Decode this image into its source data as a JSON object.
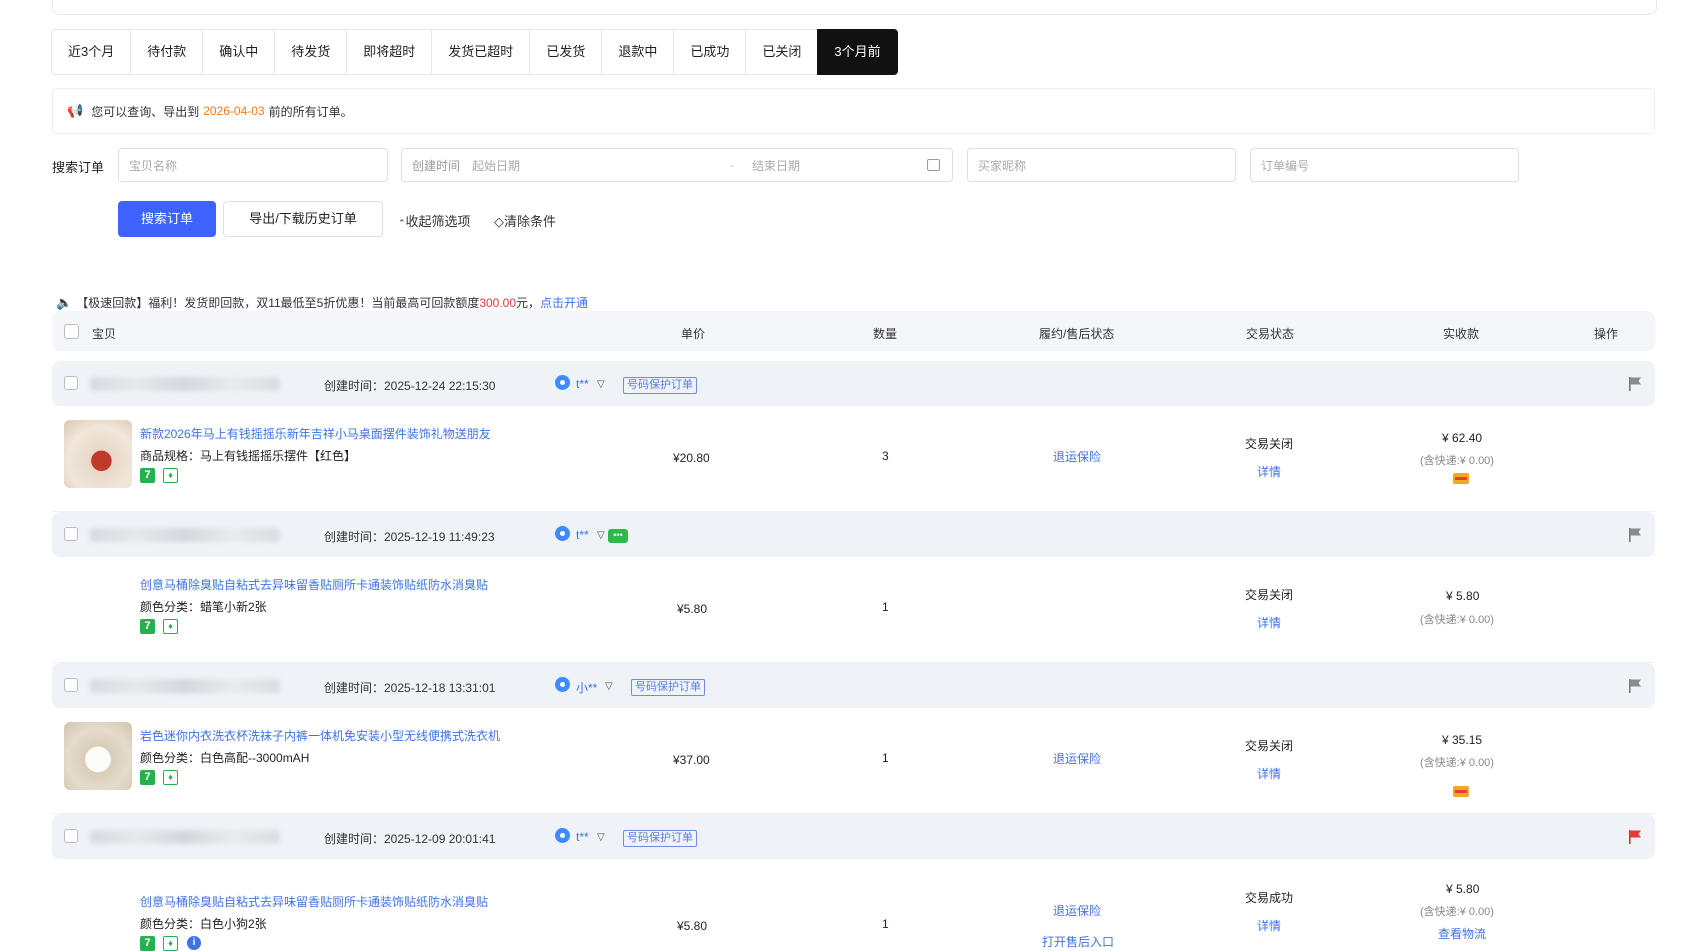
{
  "tabs": [
    "近3个月",
    "待付款",
    "确认中",
    "待发货",
    "即将超时",
    "发货已超时",
    "已发货",
    "退款中",
    "已成功",
    "已关闭",
    "3个月前"
  ],
  "active_tab": "3个月前",
  "notice": {
    "prefix": "您可以查询、导出到",
    "date": "2026-04-03",
    "suffix": "前的所有订单。"
  },
  "search": {
    "label": "搜索订单",
    "item_placeholder": "宝贝名称",
    "created_label": "创建时间",
    "start_placeholder": "起始日期",
    "range_sep": "-",
    "end_placeholder": "结束日期",
    "buyer_placeholder": "买家昵称",
    "order_placeholder": "订单编号",
    "search_btn": "搜索订单",
    "export_btn": "导出/下载历史订单",
    "collapse": "收起筛选项",
    "clear": "清除条件"
  },
  "promo": {
    "a": "【极速回款】福利！发货即回款，双11最低至5折优惠！当前最高可回款额度",
    "amount": "300.00",
    "b": "元，",
    "link": "点击开通"
  },
  "table_head": {
    "item": "宝贝",
    "price": "单价",
    "qty": "数量",
    "fulfill": "履约/售后状态",
    "trade": "交易状态",
    "paid": "实收款",
    "ops": "操作"
  },
  "colors": {
    "accent": "#3d63ff",
    "link": "#3d73e6",
    "orange": "#f07a1e",
    "red": "#e53935",
    "green": "#27b04e"
  },
  "orders": [
    {
      "created": "创建时间：2025-12-24 22:15:30",
      "buyer": "t**",
      "tag": "号码保护订单",
      "name": "新款2026年马上有钱摇摇乐新年吉祥小马桌面摆件装饰礼物送朋友",
      "spec": "商品规格：马上有钱摇摇乐摆件【红色】",
      "price": "¥20.80",
      "qty": "3",
      "fulfill": "退运保险",
      "status": "交易关闭",
      "detail": "详情",
      "amount": "¥ 62.40",
      "shipping": "(含快递:¥ 0.00)"
    },
    {
      "created": "创建时间：2025-12-19 11:49:23",
      "buyer": "t**",
      "name": "创意马桶除臭贴自粘式去异味留香贴厕所卡通装饰贴纸防水消臭贴",
      "spec": "颜色分类：蜡笔小新2张",
      "price": "¥5.80",
      "qty": "1",
      "status": "交易关闭",
      "detail": "详情",
      "amount": "¥ 5.80",
      "shipping": "(含快递:¥ 0.00)"
    },
    {
      "created": "创建时间：2025-12-18 13:31:01",
      "buyer": "小**",
      "tag": "号码保护订单",
      "name": "岩色迷你内衣洗衣杯洗袜子内裤一体机免安装小型无线便携式洗衣机",
      "spec": "颜色分类：白色高配--3000mAH",
      "price": "¥37.00",
      "qty": "1",
      "fulfill": "退运保险",
      "status": "交易关闭",
      "detail": "详情",
      "amount": "¥ 35.15",
      "shipping": "(含快递:¥ 0.00)"
    },
    {
      "created": "创建时间：2025-12-09 20:01:41",
      "buyer": "t**",
      "tag": "号码保护订单",
      "name": "创意马桶除臭贴自粘式去异味留香贴厕所卡通装饰贴纸防水消臭贴",
      "spec": "颜色分类：白色小狗2张",
      "price": "¥5.80",
      "qty": "1",
      "fulfill": "退运保险",
      "fulfill2": "打开售后入口",
      "status": "交易成功",
      "detail": "详情",
      "amount": "¥ 5.80",
      "shipping": "(含快递:¥ 0.00)",
      "logistics": "查看物流"
    }
  ]
}
